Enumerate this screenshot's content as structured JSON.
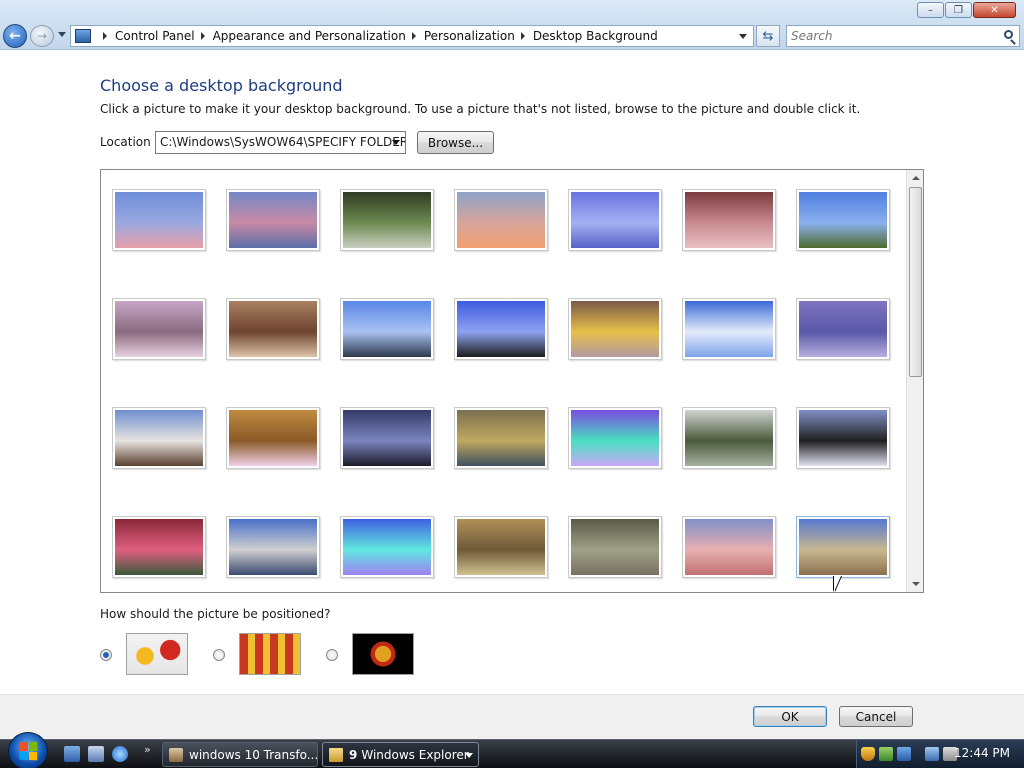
{
  "window": {
    "minimize_icon": "minimize-icon",
    "maximize_icon": "restore-icon",
    "close_icon": "close-icon"
  },
  "nav": {
    "breadcrumbs": [
      "Control Panel",
      "Appearance and Personalization",
      "Personalization",
      "Desktop Background"
    ],
    "search_placeholder": "Search"
  },
  "main": {
    "title": "Choose a desktop background",
    "subtitle": "Click a picture to make it your desktop background. To use a picture that's not listed, browse to the picture and double click it.",
    "location_label": "Location",
    "location_value": "C:\\Windows\\SysWOW64\\SPECIFY FOLDER\\",
    "browse_label": "Browse...",
    "selected_index": 27,
    "thumbnails": [
      {
        "name": "blue-sky-pink-clouds",
        "colors": [
          "#6f8fd9",
          "#9aa8e0",
          "#e7a0a8"
        ]
      },
      {
        "name": "pink-dusk-sky",
        "colors": [
          "#7488c8",
          "#c98aa6",
          "#5a6da8"
        ]
      },
      {
        "name": "green-ivy-bushes",
        "colors": [
          "#2f3a23",
          "#6d8a50",
          "#c9cfc0"
        ]
      },
      {
        "name": "bare-tree-sunset",
        "colors": [
          "#8ea3c9",
          "#d8a49a",
          "#f0a070"
        ]
      },
      {
        "name": "tree-purple-sky",
        "colors": [
          "#6a74e0",
          "#a5b0f2",
          "#5662c8"
        ]
      },
      {
        "name": "pink-blossom",
        "colors": [
          "#7a3a3e",
          "#c88b90",
          "#e9c0c4"
        ]
      },
      {
        "name": "green-field-blue-sky",
        "colors": [
          "#4f7fe0",
          "#8ab0ee",
          "#4e6b2e"
        ]
      },
      {
        "name": "birch-tree-pink",
        "colors": [
          "#c7a6c6",
          "#8a6a7e",
          "#e8d2e2"
        ]
      },
      {
        "name": "tree-bark",
        "colors": [
          "#a88060",
          "#6e4430",
          "#dcc4a8"
        ]
      },
      {
        "name": "tree-moon-blue",
        "colors": [
          "#5a86e6",
          "#a9c2f2",
          "#2e3a4a"
        ]
      },
      {
        "name": "branches-blue",
        "colors": [
          "#3e5ce0",
          "#8ea2f0",
          "#1c1c1c"
        ]
      },
      {
        "name": "daffodil",
        "colors": [
          "#7a5a4a",
          "#e7c04a",
          "#b09aa0"
        ]
      },
      {
        "name": "blue-white-clouds",
        "colors": [
          "#3a6ad8",
          "#e4ecfa",
          "#7ea1ea"
        ]
      },
      {
        "name": "purple-lake",
        "colors": [
          "#8074c0",
          "#5a58a8",
          "#b8b0e0"
        ]
      },
      {
        "name": "white-blossom-branch",
        "colors": [
          "#6f8fd0",
          "#e8e4e0",
          "#5a4030"
        ]
      },
      {
        "name": "daisy-dry-grass",
        "colors": [
          "#c08a40",
          "#8a5a28",
          "#f0d0e8"
        ]
      },
      {
        "name": "dark-branches-sky",
        "colors": [
          "#343a66",
          "#7c84c0",
          "#1c1c2a"
        ]
      },
      {
        "name": "reeds-water",
        "colors": [
          "#7a7050",
          "#c0a860",
          "#405060"
        ]
      },
      {
        "name": "purple-light-streaks",
        "colors": [
          "#7a4ae0",
          "#48e0c0",
          "#c8a8f8"
        ]
      },
      {
        "name": "white-blossom-tree",
        "colors": [
          "#d0d4d0",
          "#4a5a3a",
          "#a8b0a0"
        ]
      },
      {
        "name": "tree-sun-blue",
        "colors": [
          "#8090c8",
          "#202020",
          "#e0e0f0"
        ]
      },
      {
        "name": "red-berries",
        "colors": [
          "#8a2838",
          "#e06080",
          "#3a5a3a"
        ]
      },
      {
        "name": "lake-trees",
        "colors": [
          "#4870c8",
          "#d0d0d0",
          "#3a4a70"
        ]
      },
      {
        "name": "blue-light-rays",
        "colors": [
          "#4060e0",
          "#60e8e0",
          "#a080f0"
        ]
      },
      {
        "name": "dry-trees-water",
        "colors": [
          "#b09058",
          "#6e5a38",
          "#d0c090"
        ]
      },
      {
        "name": "shallow-water",
        "colors": [
          "#5a5a4a",
          "#a0a088",
          "#787060"
        ]
      },
      {
        "name": "pink-horizon",
        "colors": [
          "#8090c8",
          "#e8b0b0",
          "#c07070"
        ]
      },
      {
        "name": "dry-reeds-blue-sky",
        "colors": [
          "#5878d0",
          "#c8b890",
          "#8a7050"
        ]
      }
    ],
    "position_label": "How should the picture be positioned?",
    "position_options": [
      "fit-to-screen",
      "tile",
      "center"
    ],
    "position_selected": 0
  },
  "footer": {
    "ok_label": "OK",
    "cancel_label": "Cancel"
  },
  "taskbar": {
    "quick_launch_more": "»",
    "tasks": [
      {
        "label": "windows 10 Transfo...",
        "active": false
      },
      {
        "count": "9",
        "label": "Windows Explorer",
        "active": true
      }
    ],
    "clock": "12:44 PM"
  }
}
